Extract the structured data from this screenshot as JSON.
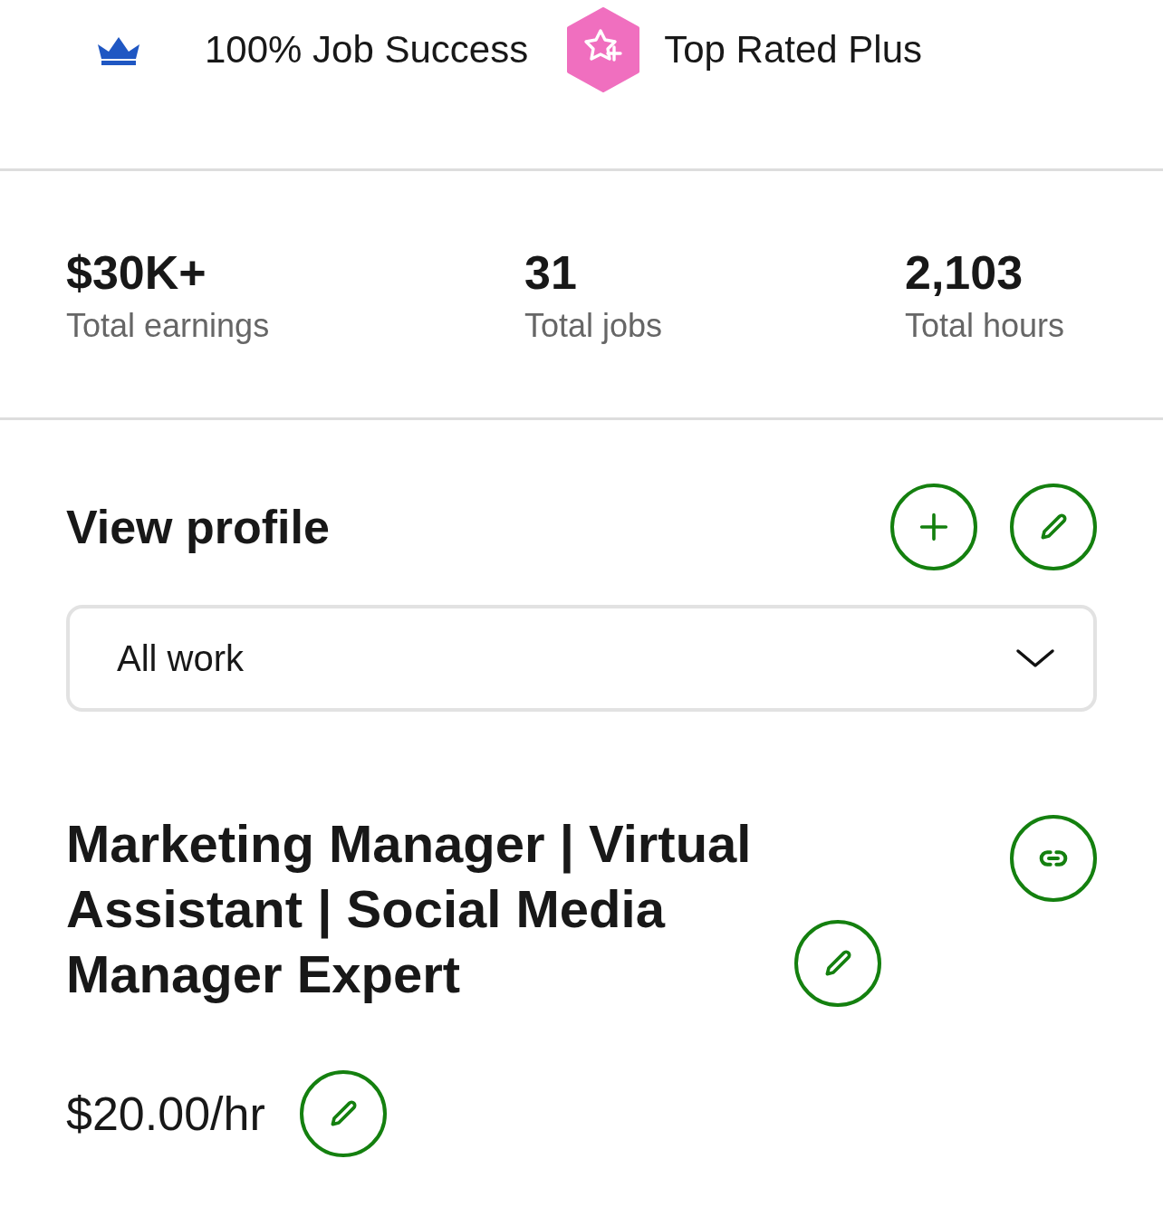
{
  "badges": [
    {
      "kind": "crown",
      "label": "100% Job Success"
    },
    {
      "kind": "top-rated-plus",
      "label": "Top Rated Plus"
    }
  ],
  "stats": [
    {
      "value": "$30K+",
      "label": "Total earnings"
    },
    {
      "value": "31",
      "label": "Total jobs"
    },
    {
      "value": "2,103",
      "label": "Total hours"
    }
  ],
  "profile": {
    "title": "View profile",
    "actions": [
      {
        "kind": "add"
      },
      {
        "kind": "edit"
      }
    ],
    "dropdown": {
      "value": "All work"
    },
    "headline": {
      "text": "Marketing Manager | Virtual Assistant | Social Media Manager Expert",
      "actions": [
        {
          "kind": "edit"
        }
      ],
      "side_actions": [
        {
          "kind": "link"
        }
      ]
    },
    "rate": {
      "text": "$20.00/hr",
      "actions": [
        {
          "kind": "edit"
        }
      ]
    }
  }
}
